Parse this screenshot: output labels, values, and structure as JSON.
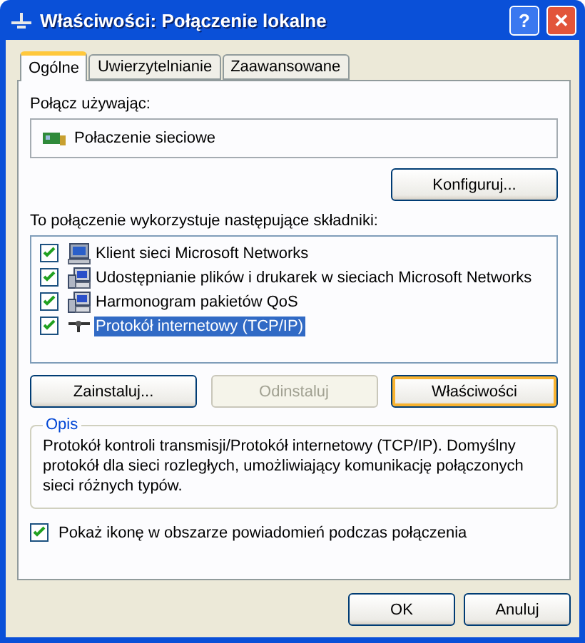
{
  "window": {
    "title": "Właściwości: Połączenie lokalne",
    "help_button": "?",
    "close_button": "✕"
  },
  "tabs": [
    {
      "label": "Ogólne",
      "selected": true
    },
    {
      "label": "Uwierzytelnianie",
      "selected": false
    },
    {
      "label": "Zaawansowane",
      "selected": false
    }
  ],
  "connect_using": {
    "label": "Połącz używając:",
    "adapter": "Połaczenie sieciowe",
    "configure_button": "Konfiguruj..."
  },
  "components": {
    "label": "To połączenie wykorzystuje następujące składniki:",
    "items": [
      {
        "kind": "client",
        "label": "Klient sieci Microsoft Networks",
        "checked": true,
        "selected": false
      },
      {
        "kind": "service",
        "label": "Udostępnianie plików i drukarek w sieciach Microsoft Networks",
        "checked": true,
        "selected": false
      },
      {
        "kind": "service",
        "label": "Harmonogram pakietów QoS",
        "checked": true,
        "selected": false
      },
      {
        "kind": "protocol",
        "label": "Protokół internetowy (TCP/IP)",
        "checked": true,
        "selected": true
      }
    ]
  },
  "component_buttons": [
    {
      "label": "Zainstaluj...",
      "disabled": false,
      "default": false
    },
    {
      "label": "Odinstaluj",
      "disabled": true,
      "default": false
    },
    {
      "label": "Właściwości",
      "disabled": false,
      "default": true
    }
  ],
  "description": {
    "legend": "Opis",
    "text": "Protokół kontroli transmisji/Protokół internetowy (TCP/IP). Domyślny protokół dla sieci rozległych, umożliwiający komunikację połączonych sieci różnych typów."
  },
  "show_icon": {
    "label": "Pokaż ikonę w obszarze powiadomień podczas połączenia",
    "checked": true
  },
  "buttons": [
    "OK",
    "Anuluj"
  ]
}
